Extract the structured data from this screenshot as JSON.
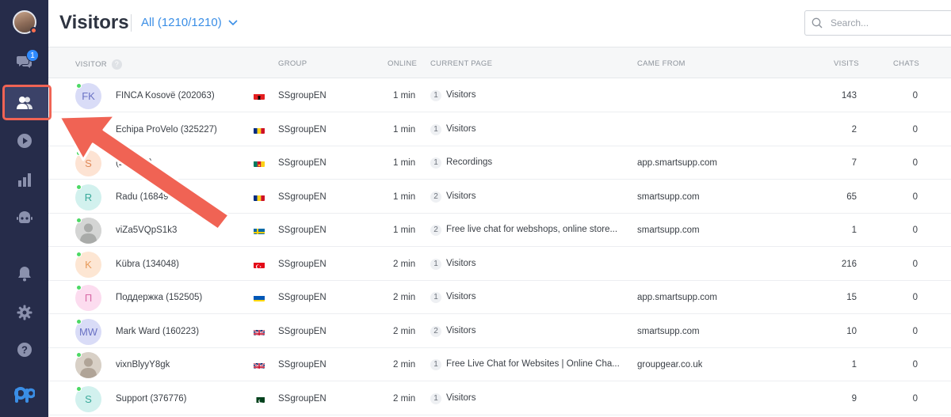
{
  "sidebar": {
    "chat_badge": "1",
    "items": [
      {
        "name": "profile-avatar"
      },
      {
        "name": "conversations-icon"
      },
      {
        "name": "visitors-icon"
      },
      {
        "name": "recordings-icon"
      },
      {
        "name": "statistics-icon"
      },
      {
        "name": "bot-icon"
      },
      {
        "name": "notifications-icon"
      },
      {
        "name": "settings-icon"
      },
      {
        "name": "help-icon"
      },
      {
        "name": "smartsupp-logo"
      }
    ]
  },
  "header": {
    "title": "Visitors",
    "filter_label": "All (1210/1210)",
    "search_placeholder": "Search..."
  },
  "table": {
    "columns": {
      "visitor": "VISITOR",
      "group": "GROUP",
      "online": "ONLINE",
      "current_page": "CURRENT PAGE",
      "came_from": "CAME FROM",
      "visits": "VISITS",
      "chats": "CHATS"
    },
    "rows": [
      {
        "initials": "FK",
        "avatar_color": "#d9dcf7",
        "initials_color": "#6a72c4",
        "name": "FINCA Kosovë (202063)",
        "flag": "al",
        "group": "SSgroupEN",
        "online": "1 min",
        "page_count": "1",
        "page": "Visitors",
        "came_from": "",
        "visits": "143",
        "chats": "0"
      },
      {
        "initials": "",
        "avatar_color": "#dbdcdc",
        "initials_color": "#888",
        "name": "Echipa ProVelo (325227)",
        "flag": "ro",
        "group": "SSgroupEN",
        "online": "1 min",
        "page_count": "1",
        "page": "Visitors",
        "came_from": "",
        "visits": "2",
        "chats": "0"
      },
      {
        "initials": "S",
        "avatar_color": "#fde3d3",
        "initials_color": "#e08a5a",
        "name": "(239509)",
        "flag": "cm",
        "group": "SSgroupEN",
        "online": "1 min",
        "page_count": "1",
        "page": "Recordings",
        "came_from": "app.smartsupp.com",
        "visits": "7",
        "chats": "0"
      },
      {
        "initials": "R",
        "avatar_color": "#d2f1ee",
        "initials_color": "#3aa99a",
        "name": "Radu (16849",
        "flag": "ro",
        "group": "SSgroupEN",
        "online": "1 min",
        "page_count": "2",
        "page": "Visitors",
        "came_from": "smartsupp.com",
        "visits": "65",
        "chats": "0"
      },
      {
        "initials": "",
        "avatar_color": "photo",
        "initials_color": "#888",
        "name": "viZa5VQpS1k3",
        "flag": "se",
        "group": "SSgroupEN",
        "online": "1 min",
        "page_count": "2",
        "page": "Free live chat for webshops, online store...",
        "came_from": "smartsupp.com",
        "visits": "1",
        "chats": "0"
      },
      {
        "initials": "K",
        "avatar_color": "#fde6d3",
        "initials_color": "#e69a5a",
        "name": "Kübra (134048)",
        "flag": "tr",
        "group": "SSgroupEN",
        "online": "2 min",
        "page_count": "1",
        "page": "Visitors",
        "came_from": "",
        "visits": "216",
        "chats": "0"
      },
      {
        "initials": "П",
        "avatar_color": "#fcdcef",
        "initials_color": "#d76aa6",
        "name": "Поддержка (152505)",
        "flag": "ua",
        "group": "SSgroupEN",
        "online": "2 min",
        "page_count": "1",
        "page": "Visitors",
        "came_from": "app.smartsupp.com",
        "visits": "15",
        "chats": "0"
      },
      {
        "initials": "MW",
        "avatar_color": "#d9dcf7",
        "initials_color": "#6a72c4",
        "name": "Mark Ward (160223)",
        "flag": "gb",
        "group": "SSgroupEN",
        "online": "2 min",
        "page_count": "2",
        "page": "Visitors",
        "came_from": "smartsupp.com",
        "visits": "10",
        "chats": "0"
      },
      {
        "initials": "",
        "avatar_color": "photo2",
        "initials_color": "#888",
        "name": "vixnBlyyY8gk",
        "flag": "gb",
        "group": "SSgroupEN",
        "online": "2 min",
        "page_count": "1",
        "page": "Free Live Chat for Websites | Online Cha...",
        "came_from": "groupgear.co.uk",
        "visits": "1",
        "chats": "0"
      },
      {
        "initials": "S",
        "avatar_color": "#d2f1ee",
        "initials_color": "#3aa99a",
        "name": "Support (376776)",
        "flag": "pk",
        "group": "SSgroupEN",
        "online": "2 min",
        "page_count": "1",
        "page": "Visitors",
        "came_from": "",
        "visits": "9",
        "chats": "0"
      }
    ]
  },
  "colors": {
    "sidebar_bg": "#262c4a",
    "accent_blue": "#3a8ee6",
    "annotation_red": "#f06354",
    "online_green": "#4cd964"
  }
}
